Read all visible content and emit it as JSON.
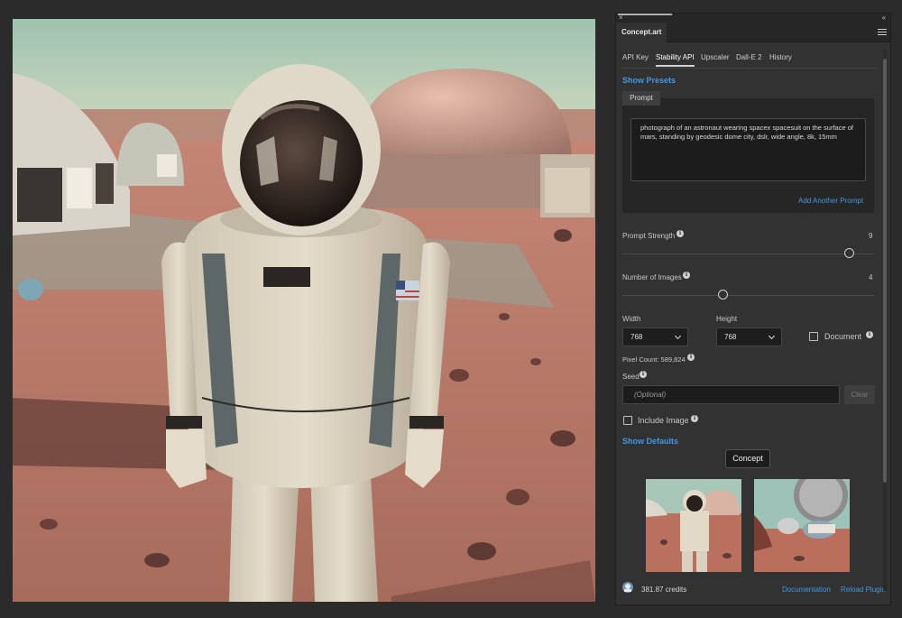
{
  "panel": {
    "title": "Concept.art",
    "close_glyph": "×",
    "collapse_glyph": "‹‹"
  },
  "tabs": [
    {
      "label": "API Key"
    },
    {
      "label": "Stability API",
      "active": true
    },
    {
      "label": "Upscaler"
    },
    {
      "label": "Dall-E 2"
    },
    {
      "label": "History"
    }
  ],
  "presets": {
    "label": "Show Presets"
  },
  "prompt": {
    "tab_label": "Prompt",
    "text": "photograph of an astronaut wearing spacex spacesuit on the surface of mars, standing by geodesic dome city, dslr, wide angle, 8k, 15mm",
    "add_label": "Add Another Prompt"
  },
  "prompt_strength": {
    "label": "Prompt Strength",
    "value": "9",
    "min": 0,
    "max": 10,
    "fraction": 0.9
  },
  "num_images": {
    "label": "Number of Images",
    "value": "4",
    "min": 1,
    "max": 10,
    "fraction": 0.4
  },
  "width": {
    "label": "Width",
    "value": "768"
  },
  "height": {
    "label": "Height",
    "value": "768"
  },
  "document": {
    "label": "Document",
    "checked": false
  },
  "pixel_count": {
    "label": "Pixel Count: 589,824"
  },
  "seed": {
    "label": "Seed",
    "placeholder": "(Optional)",
    "clear_label": "Clear"
  },
  "include_image": {
    "label": "Include Image",
    "checked": false
  },
  "defaults": {
    "label": "Show Defaults"
  },
  "concept_button": {
    "label": "Concept"
  },
  "footer": {
    "credits": "381.87 credits",
    "documentation": "Documentation",
    "reload": "Reload Plugin"
  },
  "icons": {
    "info": "info-icon",
    "menu": "hamburger-menu-icon",
    "chevron": "chevron-down-icon"
  },
  "colors": {
    "accent": "#3f9ae8",
    "panel_bg": "#323232",
    "app_bg": "#2b2b2b"
  }
}
